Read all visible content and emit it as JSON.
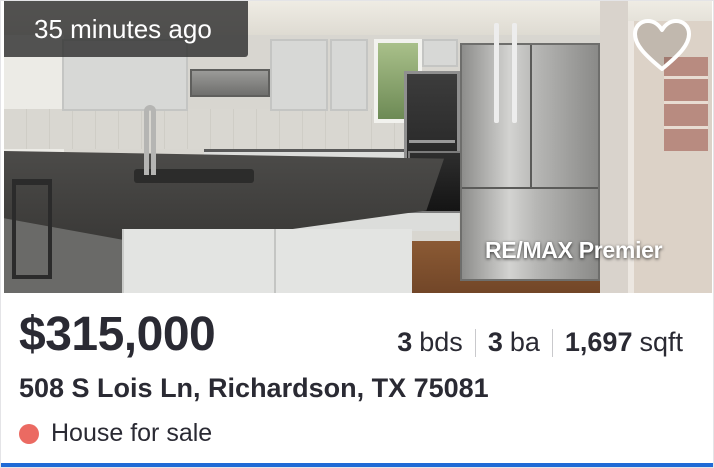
{
  "listing": {
    "time_badge": "35 minutes ago",
    "brokerage": "RE/MAX Premier",
    "price": "$315,000",
    "beds": {
      "value": "3",
      "unit": "bds"
    },
    "baths": {
      "value": "3",
      "unit": "ba"
    },
    "sqft": {
      "value": "1,697",
      "unit": "sqft"
    },
    "address": "508 S Lois Ln, Richardson, TX 75081",
    "status": "House for sale"
  },
  "icons": {
    "favorite": "heart-outline-icon",
    "status": "status-dot-icon"
  },
  "colors": {
    "status_dot": "#eb6a62",
    "accent_bar": "#1f6ad6",
    "text": "#2a2a33"
  }
}
